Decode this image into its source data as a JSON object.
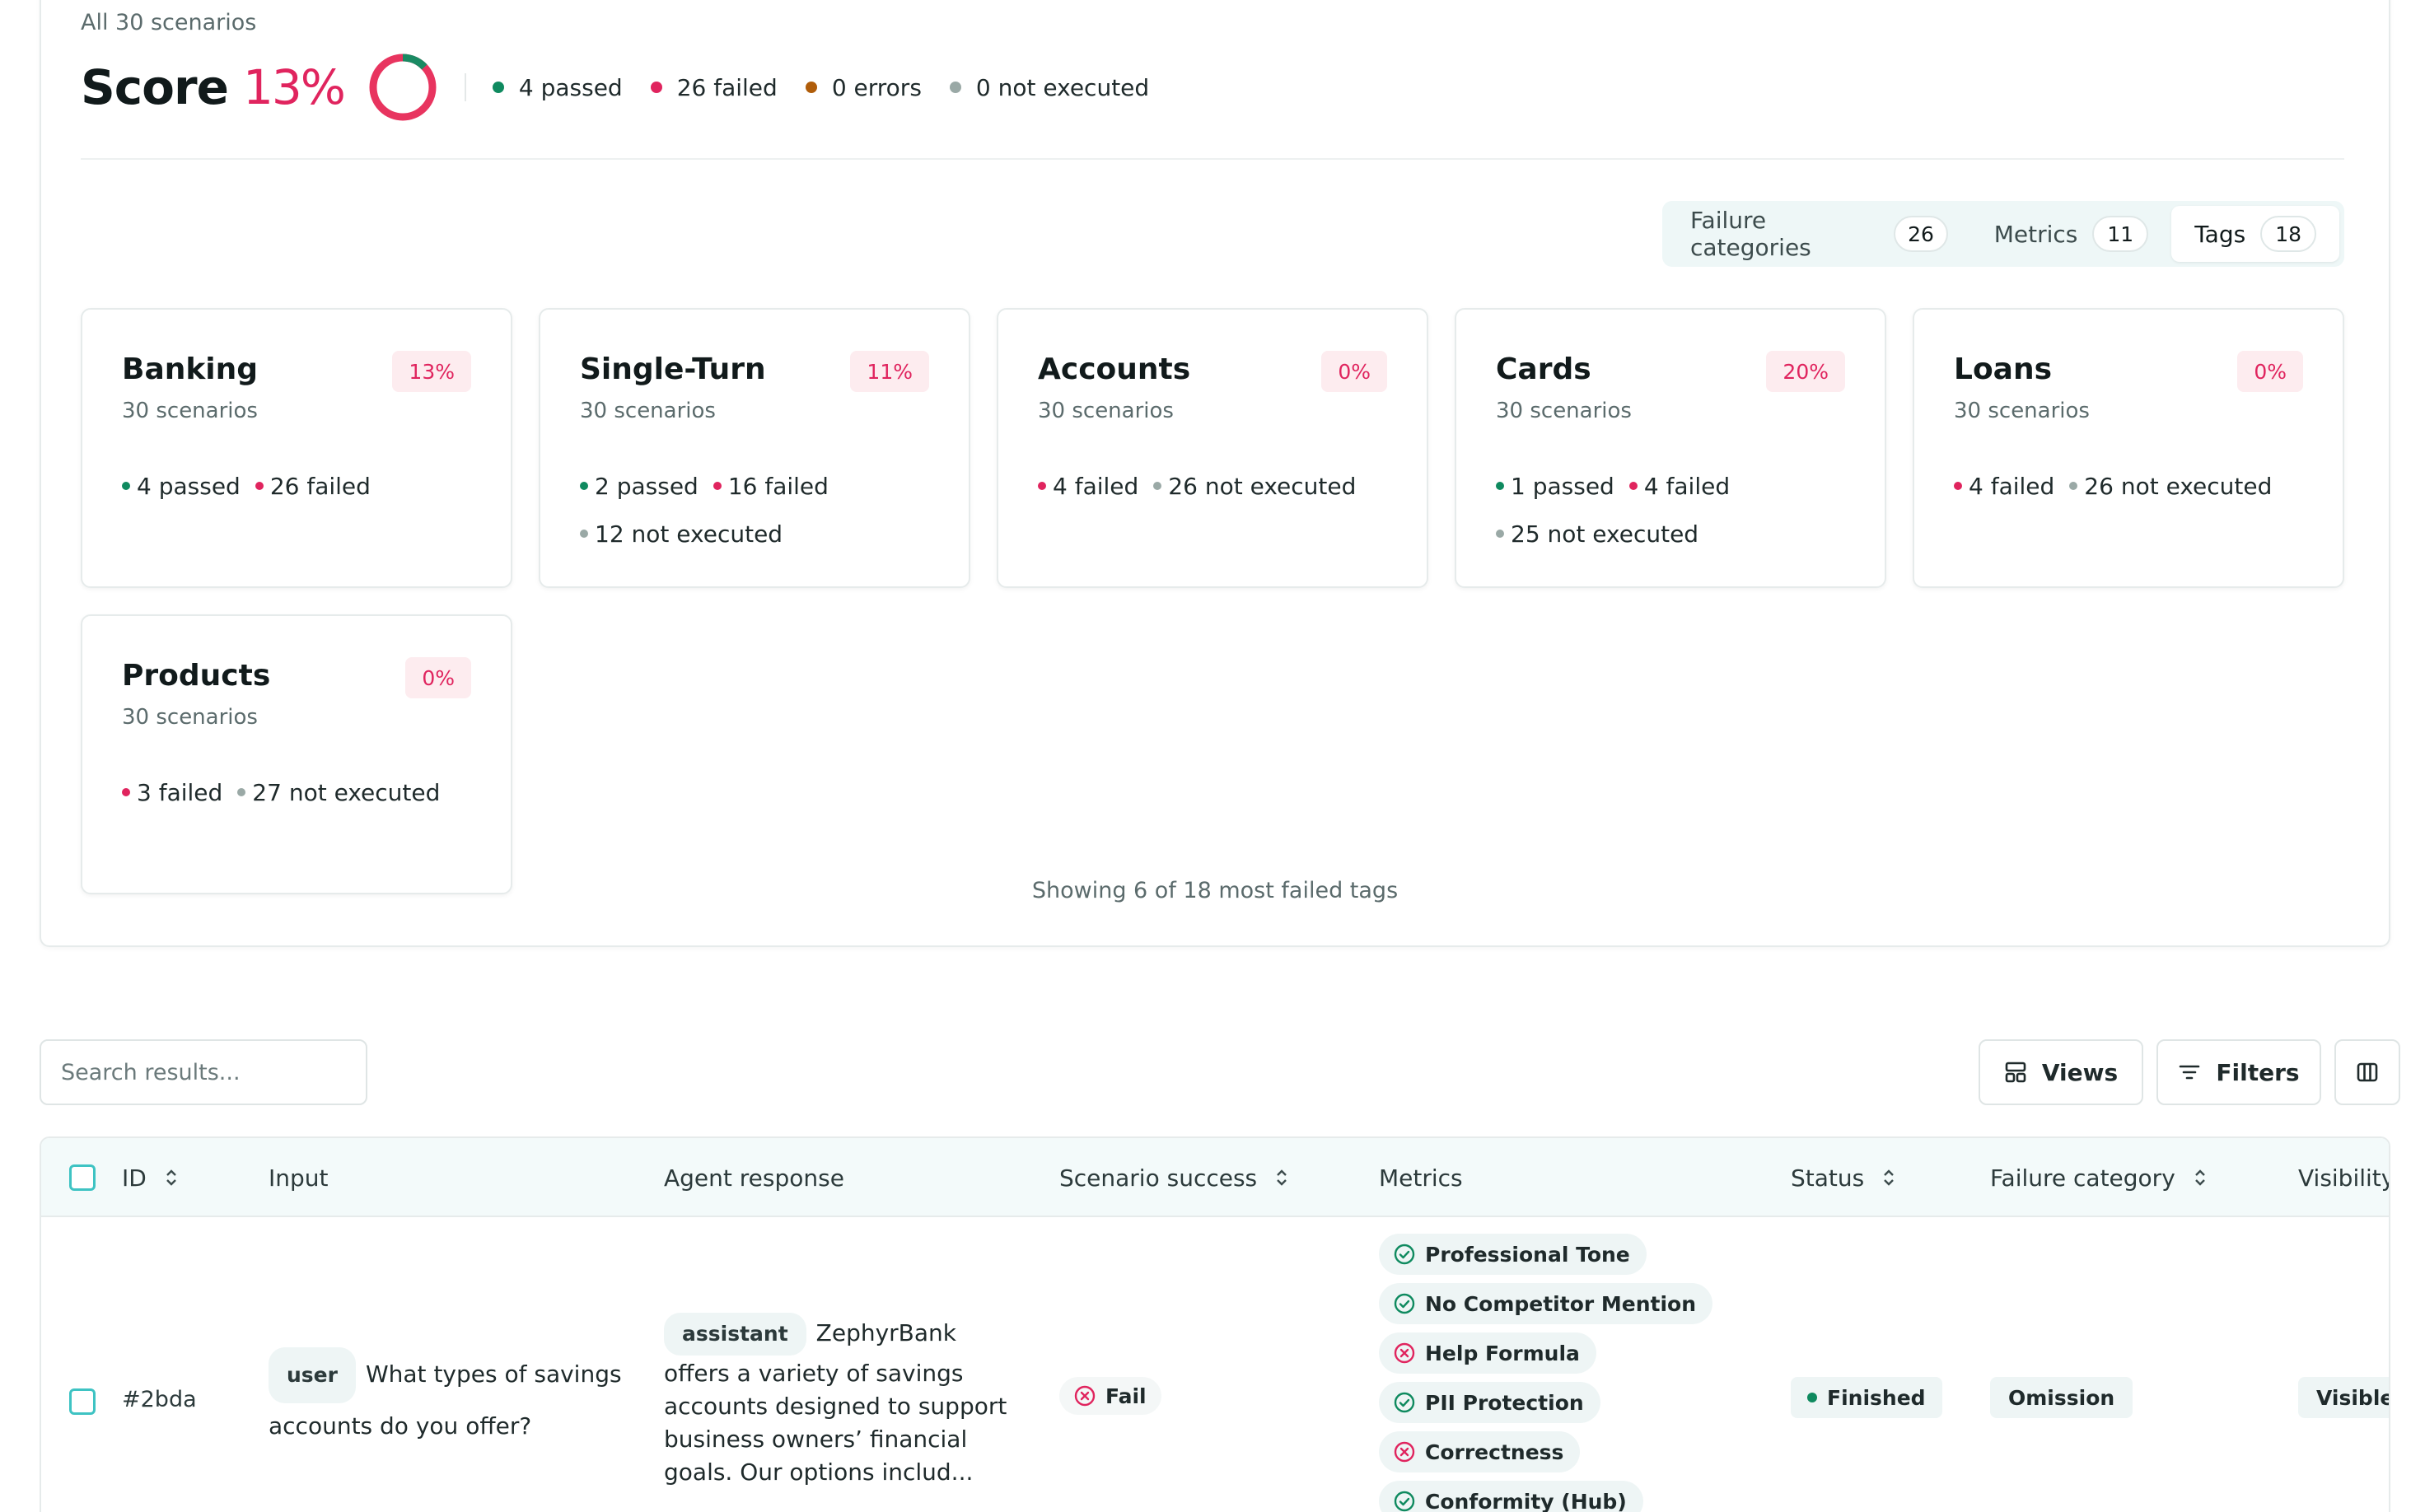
{
  "summary": {
    "scope_label": "All 30 scenarios",
    "score_label": "Score",
    "score_value": "13%",
    "score_fraction": 0.13,
    "legend": [
      {
        "label": "4 passed",
        "color": "#0f8a5f"
      },
      {
        "label": "26 failed",
        "color": "#e0245e"
      },
      {
        "label": "0 errors",
        "color": "#b05d0a"
      },
      {
        "label": "0 not executed",
        "color": "#9aa9a6"
      }
    ],
    "showing_text": "Showing 6 of 18 most failed tags"
  },
  "segments": [
    {
      "label": "Failure categories",
      "count": "26",
      "active": false
    },
    {
      "label": "Metrics",
      "count": "11",
      "active": false
    },
    {
      "label": "Tags",
      "count": "18",
      "active": true
    }
  ],
  "tags": [
    {
      "name": "Banking",
      "sub": "30 scenarios",
      "pct": "13%",
      "stats": [
        {
          "label": "4 passed",
          "kind": "passed"
        },
        {
          "label": "26 failed",
          "kind": "failed"
        }
      ]
    },
    {
      "name": "Single-Turn",
      "sub": "30 scenarios",
      "pct": "11%",
      "stats": [
        {
          "label": "2 passed",
          "kind": "passed"
        },
        {
          "label": "16 failed",
          "kind": "failed"
        },
        {
          "label": "12 not executed",
          "kind": "not_executed"
        }
      ]
    },
    {
      "name": "Accounts",
      "sub": "30 scenarios",
      "pct": "0%",
      "stats": [
        {
          "label": "4 failed",
          "kind": "failed"
        },
        {
          "label": "26 not executed",
          "kind": "not_executed"
        }
      ]
    },
    {
      "name": "Cards",
      "sub": "30 scenarios",
      "pct": "20%",
      "stats": [
        {
          "label": "1 passed",
          "kind": "passed"
        },
        {
          "label": "4 failed",
          "kind": "failed"
        },
        {
          "label": "25 not executed",
          "kind": "not_executed"
        }
      ]
    },
    {
      "name": "Loans",
      "sub": "30 scenarios",
      "pct": "0%",
      "stats": [
        {
          "label": "4 failed",
          "kind": "failed"
        },
        {
          "label": "26 not executed",
          "kind": "not_executed"
        }
      ]
    },
    {
      "name": "Products",
      "sub": "30 scenarios",
      "pct": "0%",
      "stats": [
        {
          "label": "3 failed",
          "kind": "failed"
        },
        {
          "label": "27 not executed",
          "kind": "not_executed"
        }
      ]
    }
  ],
  "status_colors": {
    "passed": "#0f8a5f",
    "failed": "#e0245e",
    "error": "#b05d0a",
    "not_executed": "#9aa9a6"
  },
  "toolbar": {
    "search_placeholder": "Search results...",
    "views_label": "Views",
    "filters_label": "Filters"
  },
  "table": {
    "columns": {
      "id": "ID",
      "input": "Input",
      "agent_response": "Agent response",
      "scenario_success": "Scenario success",
      "metrics": "Metrics",
      "status": "Status",
      "failure_category": "Failure category",
      "visibility": "Visibility"
    },
    "rows": [
      {
        "id": "#2bda",
        "input_role": "user",
        "input_text": "What types of savings accounts do you offer?",
        "response_role": "assistant",
        "response_first": "ZephyrBank",
        "response_rest": "offers a variety of savings accounts designed to support business owners’ financial goals. Our options includ...",
        "scenario_success": "Fail",
        "metrics": [
          {
            "name": "Professional Tone",
            "result": "pass"
          },
          {
            "name": "No Competitor Mention",
            "result": "pass"
          },
          {
            "name": "Help Formula",
            "result": "fail"
          },
          {
            "name": "PII Protection",
            "result": "pass"
          },
          {
            "name": "Correctness",
            "result": "fail"
          },
          {
            "name": "Conformity (Hub)",
            "result": "pass"
          }
        ],
        "status": "Finished",
        "failure_category": "Omission",
        "visibility": "Visible"
      }
    ]
  }
}
